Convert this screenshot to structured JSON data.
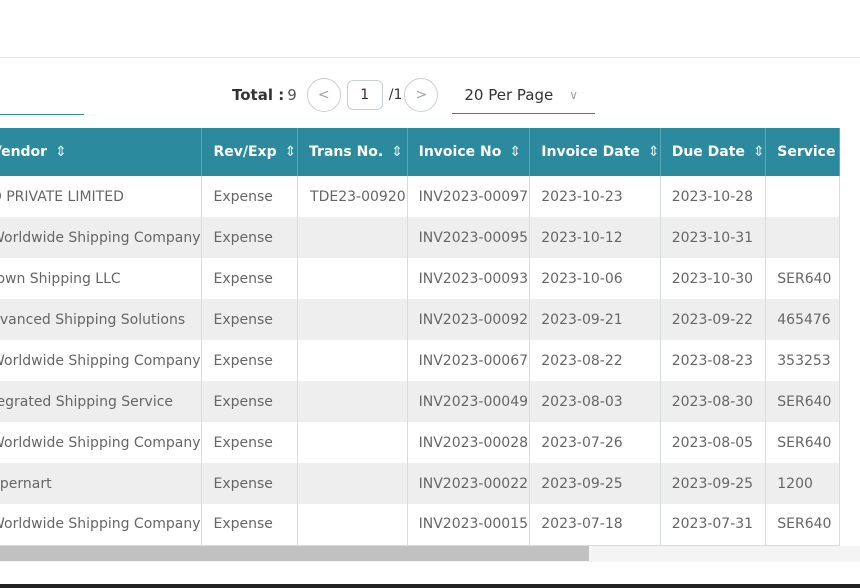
{
  "pager": {
    "total_label": "Total :",
    "total_value": "9",
    "prev_icon": "<",
    "current_page": "1",
    "page_count": "/1",
    "next_icon": ">",
    "per_page": "20 Per Page",
    "chevron": "∨"
  },
  "table": {
    "headers": {
      "vendor": "Vendor",
      "rev_exp": "Rev/Exp",
      "trans_no": "Trans No.",
      "invoice_no": "Invoice No",
      "invoice_date": "Invoice Date",
      "due_date": "Due Date",
      "service": "Service"
    },
    "sort_icon": "⇕",
    "rows": [
      {
        "vendor": "D PRIVATE LIMITED",
        "rev_exp": "Expense",
        "trans_no": "TDE23-00920",
        "invoice_no": "INV2023-00097",
        "invoice_date": "2023-10-23",
        "due_date": "2023-10-28",
        "service": ""
      },
      {
        "vendor": "Worldwide Shipping Company",
        "rev_exp": "Expense",
        "trans_no": "",
        "invoice_no": "INV2023-00095",
        "invoice_date": "2023-10-12",
        "due_date": "2023-10-31",
        "service": ""
      },
      {
        "vendor": "rown Shipping LLC",
        "rev_exp": "Expense",
        "trans_no": "",
        "invoice_no": "INV2023-00093",
        "invoice_date": "2023-10-06",
        "due_date": "2023-10-30",
        "service": "SER640"
      },
      {
        "vendor": "dvanced Shipping Solutions",
        "rev_exp": "Expense",
        "trans_no": "",
        "invoice_no": "INV2023-00092",
        "invoice_date": "2023-09-21",
        "due_date": "2023-09-22",
        "service": "465476"
      },
      {
        "vendor": "Worldwide Shipping Company",
        "rev_exp": "Expense",
        "trans_no": "",
        "invoice_no": "INV2023-00067",
        "invoice_date": "2023-08-22",
        "due_date": "2023-08-23",
        "service": "353253"
      },
      {
        "vendor": "tegrated Shipping Service",
        "rev_exp": "Expense",
        "trans_no": "",
        "invoice_no": "INV2023-00049",
        "invoice_date": "2023-08-03",
        "due_date": "2023-08-30",
        "service": "SER640"
      },
      {
        "vendor": "Worldwide Shipping Company",
        "rev_exp": "Expense",
        "trans_no": "",
        "invoice_no": "INV2023-00028",
        "invoice_date": "2023-07-26",
        "due_date": "2023-08-05",
        "service": "SER640"
      },
      {
        "vendor": "upernart",
        "rev_exp": "Expense",
        "trans_no": "",
        "invoice_no": "INV2023-00022",
        "invoice_date": "2023-09-25",
        "due_date": "2023-09-25",
        "service": "1200"
      },
      {
        "vendor": "Worldwide Shipping Company",
        "rev_exp": "Expense",
        "trans_no": "",
        "invoice_no": "INV2023-00015",
        "invoice_date": "2023-07-18",
        "due_date": "2023-07-31",
        "service": "SER640"
      }
    ]
  },
  "colors": {
    "header_bg": "#2b8a9e",
    "vendor_text": "#a0336d",
    "invoice_no_text": "#2b8a9e",
    "invoice_date_text": "#3a5ec8",
    "due_date_text": "#e0202e",
    "alt_row_bg": "#eeeeee"
  }
}
